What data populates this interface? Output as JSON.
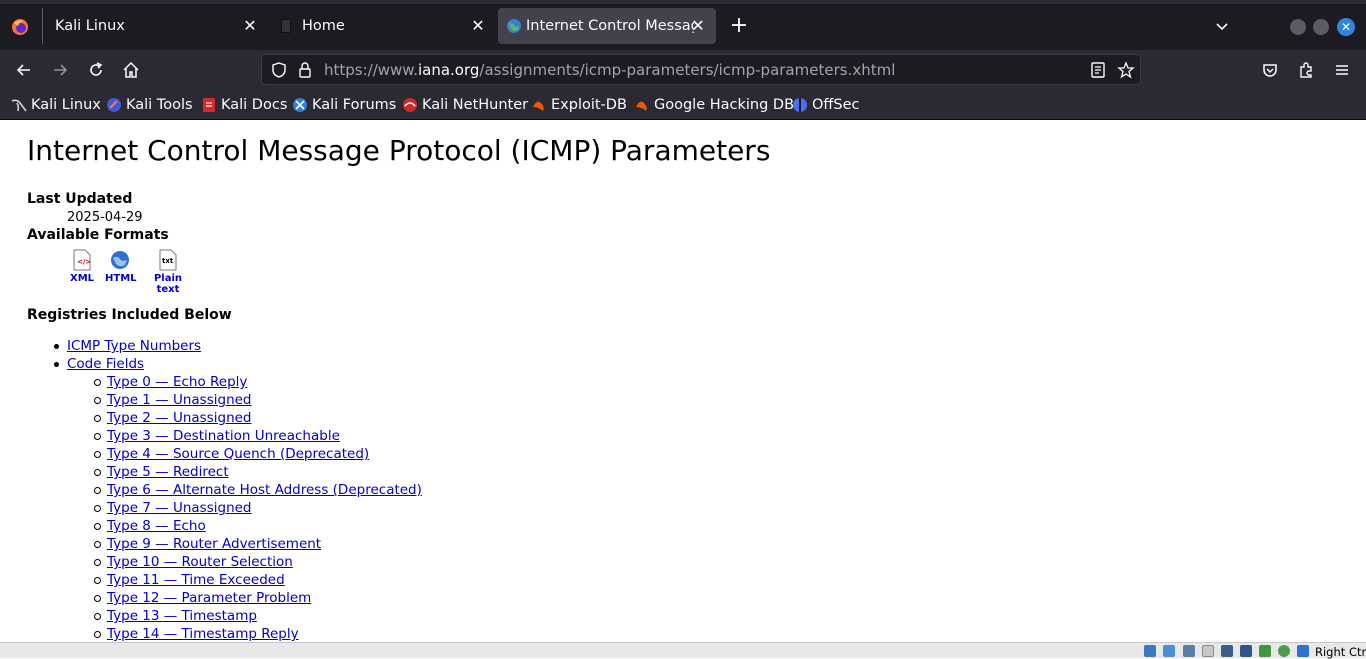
{
  "browser": {
    "tabs": [
      {
        "label": "Kali Linux",
        "active": false
      },
      {
        "label": "Home",
        "active": false
      },
      {
        "label": "Internet Control Message Protocol (ICMP) Parameters",
        "active": true
      }
    ],
    "url": {
      "scheme": "https://www.",
      "host": "iana.org",
      "path": "/assignments/icmp-parameters/icmp-parameters.xhtml"
    },
    "bookmarks": [
      {
        "label": "Kali Linux",
        "icon": "kali-dragon-icon"
      },
      {
        "label": "Kali Tools",
        "icon": "kali-tools-icon"
      },
      {
        "label": "Kali Docs",
        "icon": "kali-docs-icon"
      },
      {
        "label": "Kali Forums",
        "icon": "kali-forums-icon"
      },
      {
        "label": "Kali NetHunter",
        "icon": "nethunter-icon"
      },
      {
        "label": "Exploit-DB",
        "icon": "exploit-db-icon"
      },
      {
        "label": "Google Hacking DB",
        "icon": "ghdb-icon"
      },
      {
        "label": "OffSec",
        "icon": "offsec-icon"
      }
    ]
  },
  "page": {
    "title": "Internet Control Message Protocol (ICMP) Parameters",
    "last_updated_label": "Last Updated",
    "last_updated_value": "2025-04-29",
    "formats_label": "Available Formats",
    "formats": [
      {
        "label": "XML",
        "icon": "xml-file-icon"
      },
      {
        "label": "HTML",
        "icon": "html-globe-icon"
      },
      {
        "label": "Plain text",
        "icon": "txt-file-icon"
      }
    ],
    "registries_label": "Registries Included Below",
    "registries": [
      {
        "label": "ICMP Type Numbers"
      },
      {
        "label": "Code Fields"
      }
    ],
    "code_fields": [
      "Type 0 — Echo Reply",
      "Type 1 — Unassigned",
      "Type 2 — Unassigned",
      "Type 3 — Destination Unreachable",
      "Type 4 — Source Quench (Deprecated)",
      "Type 5 — Redirect",
      "Type 6 — Alternate Host Address (Deprecated)",
      "Type 7 — Unassigned",
      "Type 8 — Echo",
      "Type 9 — Router Advertisement",
      "Type 10 — Router Selection",
      "Type 11 — Time Exceeded",
      "Type 12 — Parameter Problem",
      "Type 13 — Timestamp",
      "Type 14 — Timestamp Reply"
    ]
  },
  "vm_status": {
    "host_key": "Right Ctrl"
  },
  "colors": {
    "link": "#0000cc",
    "chrome_dark": "#1c1b22",
    "chrome_mid": "#2b2a33",
    "active_tab": "#42414d",
    "close_accent": "#2e86de"
  }
}
